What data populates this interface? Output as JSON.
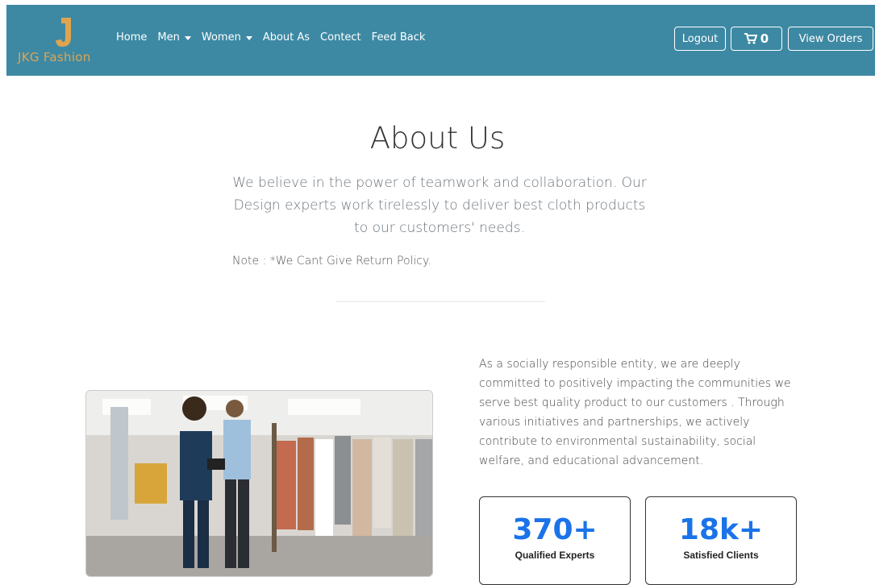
{
  "brand": {
    "name": "JKG Fashion"
  },
  "nav": {
    "links": [
      {
        "label": "Home",
        "dropdown": false
      },
      {
        "label": "Men",
        "dropdown": true
      },
      {
        "label": "Women",
        "dropdown": true
      },
      {
        "label": "About As",
        "dropdown": false
      },
      {
        "label": "Contect",
        "dropdown": false
      },
      {
        "label": "Feed Back",
        "dropdown": false
      }
    ],
    "logout_label": "Logout",
    "cart_count": "0",
    "view_orders_label": "View Orders"
  },
  "about": {
    "title": "About Us",
    "lead": "We believe in the power of teamwork and collaboration. Our Design experts work tirelessly to deliver best cloth products to our customers' needs.",
    "note": "Note : *We Cant Give Return Policy.",
    "paragraph": "As a socially responsible entity, we are deeply committed to positively impacting the communities we serve best quality product to our customers . Through various initiatives and partnerships, we actively contribute to environmental sustainability, social welfare, and educational advancement."
  },
  "stats": [
    {
      "value": "370+",
      "label": "Qualified Experts"
    },
    {
      "value": "18k+",
      "label": "Satisfied Clients"
    }
  ],
  "colors": {
    "navbar": "#3d89a4",
    "logo": "#e0a44f",
    "stat_number": "#1a73e8"
  }
}
